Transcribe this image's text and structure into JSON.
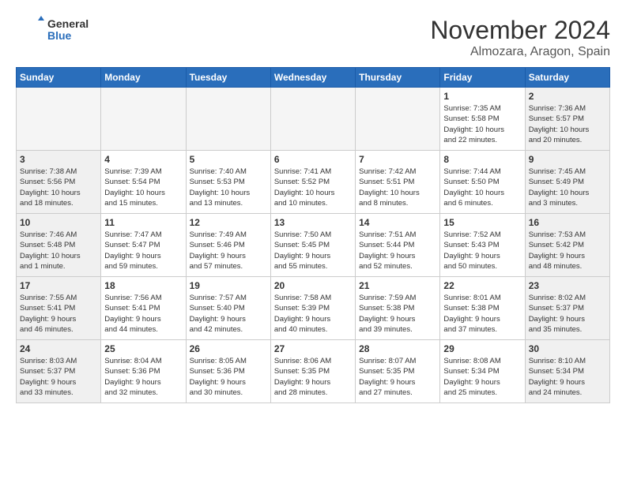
{
  "header": {
    "logo_general": "General",
    "logo_blue": "Blue",
    "month": "November 2024",
    "location": "Almozara, Aragon, Spain"
  },
  "weekdays": [
    "Sunday",
    "Monday",
    "Tuesday",
    "Wednesday",
    "Thursday",
    "Friday",
    "Saturday"
  ],
  "weeks": [
    [
      {
        "day": "",
        "info": ""
      },
      {
        "day": "",
        "info": ""
      },
      {
        "day": "",
        "info": ""
      },
      {
        "day": "",
        "info": ""
      },
      {
        "day": "",
        "info": ""
      },
      {
        "day": "1",
        "info": "Sunrise: 7:35 AM\nSunset: 5:58 PM\nDaylight: 10 hours\nand 22 minutes."
      },
      {
        "day": "2",
        "info": "Sunrise: 7:36 AM\nSunset: 5:57 PM\nDaylight: 10 hours\nand 20 minutes."
      }
    ],
    [
      {
        "day": "3",
        "info": "Sunrise: 7:38 AM\nSunset: 5:56 PM\nDaylight: 10 hours\nand 18 minutes."
      },
      {
        "day": "4",
        "info": "Sunrise: 7:39 AM\nSunset: 5:54 PM\nDaylight: 10 hours\nand 15 minutes."
      },
      {
        "day": "5",
        "info": "Sunrise: 7:40 AM\nSunset: 5:53 PM\nDaylight: 10 hours\nand 13 minutes."
      },
      {
        "day": "6",
        "info": "Sunrise: 7:41 AM\nSunset: 5:52 PM\nDaylight: 10 hours\nand 10 minutes."
      },
      {
        "day": "7",
        "info": "Sunrise: 7:42 AM\nSunset: 5:51 PM\nDaylight: 10 hours\nand 8 minutes."
      },
      {
        "day": "8",
        "info": "Sunrise: 7:44 AM\nSunset: 5:50 PM\nDaylight: 10 hours\nand 6 minutes."
      },
      {
        "day": "9",
        "info": "Sunrise: 7:45 AM\nSunset: 5:49 PM\nDaylight: 10 hours\nand 3 minutes."
      }
    ],
    [
      {
        "day": "10",
        "info": "Sunrise: 7:46 AM\nSunset: 5:48 PM\nDaylight: 10 hours\nand 1 minute."
      },
      {
        "day": "11",
        "info": "Sunrise: 7:47 AM\nSunset: 5:47 PM\nDaylight: 9 hours\nand 59 minutes."
      },
      {
        "day": "12",
        "info": "Sunrise: 7:49 AM\nSunset: 5:46 PM\nDaylight: 9 hours\nand 57 minutes."
      },
      {
        "day": "13",
        "info": "Sunrise: 7:50 AM\nSunset: 5:45 PM\nDaylight: 9 hours\nand 55 minutes."
      },
      {
        "day": "14",
        "info": "Sunrise: 7:51 AM\nSunset: 5:44 PM\nDaylight: 9 hours\nand 52 minutes."
      },
      {
        "day": "15",
        "info": "Sunrise: 7:52 AM\nSunset: 5:43 PM\nDaylight: 9 hours\nand 50 minutes."
      },
      {
        "day": "16",
        "info": "Sunrise: 7:53 AM\nSunset: 5:42 PM\nDaylight: 9 hours\nand 48 minutes."
      }
    ],
    [
      {
        "day": "17",
        "info": "Sunrise: 7:55 AM\nSunset: 5:41 PM\nDaylight: 9 hours\nand 46 minutes."
      },
      {
        "day": "18",
        "info": "Sunrise: 7:56 AM\nSunset: 5:41 PM\nDaylight: 9 hours\nand 44 minutes."
      },
      {
        "day": "19",
        "info": "Sunrise: 7:57 AM\nSunset: 5:40 PM\nDaylight: 9 hours\nand 42 minutes."
      },
      {
        "day": "20",
        "info": "Sunrise: 7:58 AM\nSunset: 5:39 PM\nDaylight: 9 hours\nand 40 minutes."
      },
      {
        "day": "21",
        "info": "Sunrise: 7:59 AM\nSunset: 5:38 PM\nDaylight: 9 hours\nand 39 minutes."
      },
      {
        "day": "22",
        "info": "Sunrise: 8:01 AM\nSunset: 5:38 PM\nDaylight: 9 hours\nand 37 minutes."
      },
      {
        "day": "23",
        "info": "Sunrise: 8:02 AM\nSunset: 5:37 PM\nDaylight: 9 hours\nand 35 minutes."
      }
    ],
    [
      {
        "day": "24",
        "info": "Sunrise: 8:03 AM\nSunset: 5:37 PM\nDaylight: 9 hours\nand 33 minutes."
      },
      {
        "day": "25",
        "info": "Sunrise: 8:04 AM\nSunset: 5:36 PM\nDaylight: 9 hours\nand 32 minutes."
      },
      {
        "day": "26",
        "info": "Sunrise: 8:05 AM\nSunset: 5:36 PM\nDaylight: 9 hours\nand 30 minutes."
      },
      {
        "day": "27",
        "info": "Sunrise: 8:06 AM\nSunset: 5:35 PM\nDaylight: 9 hours\nand 28 minutes."
      },
      {
        "day": "28",
        "info": "Sunrise: 8:07 AM\nSunset: 5:35 PM\nDaylight: 9 hours\nand 27 minutes."
      },
      {
        "day": "29",
        "info": "Sunrise: 8:08 AM\nSunset: 5:34 PM\nDaylight: 9 hours\nand 25 minutes."
      },
      {
        "day": "30",
        "info": "Sunrise: 8:10 AM\nSunset: 5:34 PM\nDaylight: 9 hours\nand 24 minutes."
      }
    ]
  ]
}
